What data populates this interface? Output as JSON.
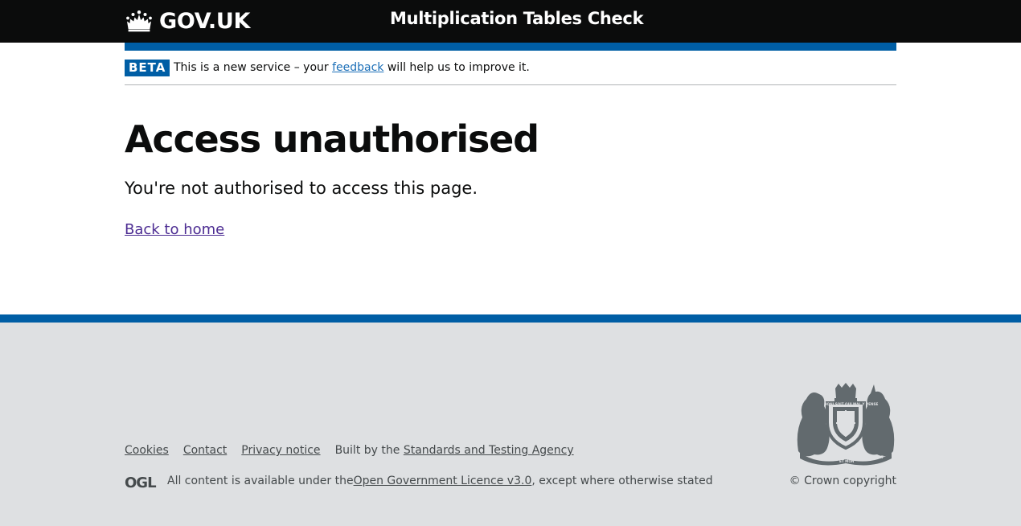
{
  "header": {
    "logo_text": "GOV.UK",
    "service_name": "Multiplication Tables Check"
  },
  "phase_banner": {
    "tag": "BETA",
    "text_before": "This is a new service – your ",
    "link_text": "feedback",
    "text_after": " will help us to improve it."
  },
  "main": {
    "title": "Access unauthorised",
    "body": "You're not authorised to access this page.",
    "back_link": "Back to home"
  },
  "footer": {
    "links": {
      "cookies": "Cookies",
      "contact": "Contact",
      "privacy": "Privacy notice"
    },
    "built_by_prefix": "Built by the ",
    "built_by_link": "Standards and Testing Agency",
    "licence_prefix": "All content is available under the ",
    "licence_link": "Open Government Licence v3.0",
    "licence_suffix": ", except where otherwise stated",
    "ogl_logo": "OGL",
    "crest_text": {
      "top": "HONI SOIT QUI MAL Y PENSE",
      "left": "DIEU",
      "right": "DROIT",
      "bottom": "ET MON"
    },
    "copyright": "© Crown copyright"
  },
  "colors": {
    "header_bg": "#0b0c0c",
    "brand_blue": "#005ea5",
    "link_blue": "#1d70b8",
    "visited_link": "#4c2c92",
    "footer_bg": "#dee0e2",
    "footer_text": "#454a4c"
  },
  "icons": {
    "logo": "crown-icon",
    "licence": "ogl-logo-icon",
    "crest": "royal-coat-of-arms-icon"
  }
}
